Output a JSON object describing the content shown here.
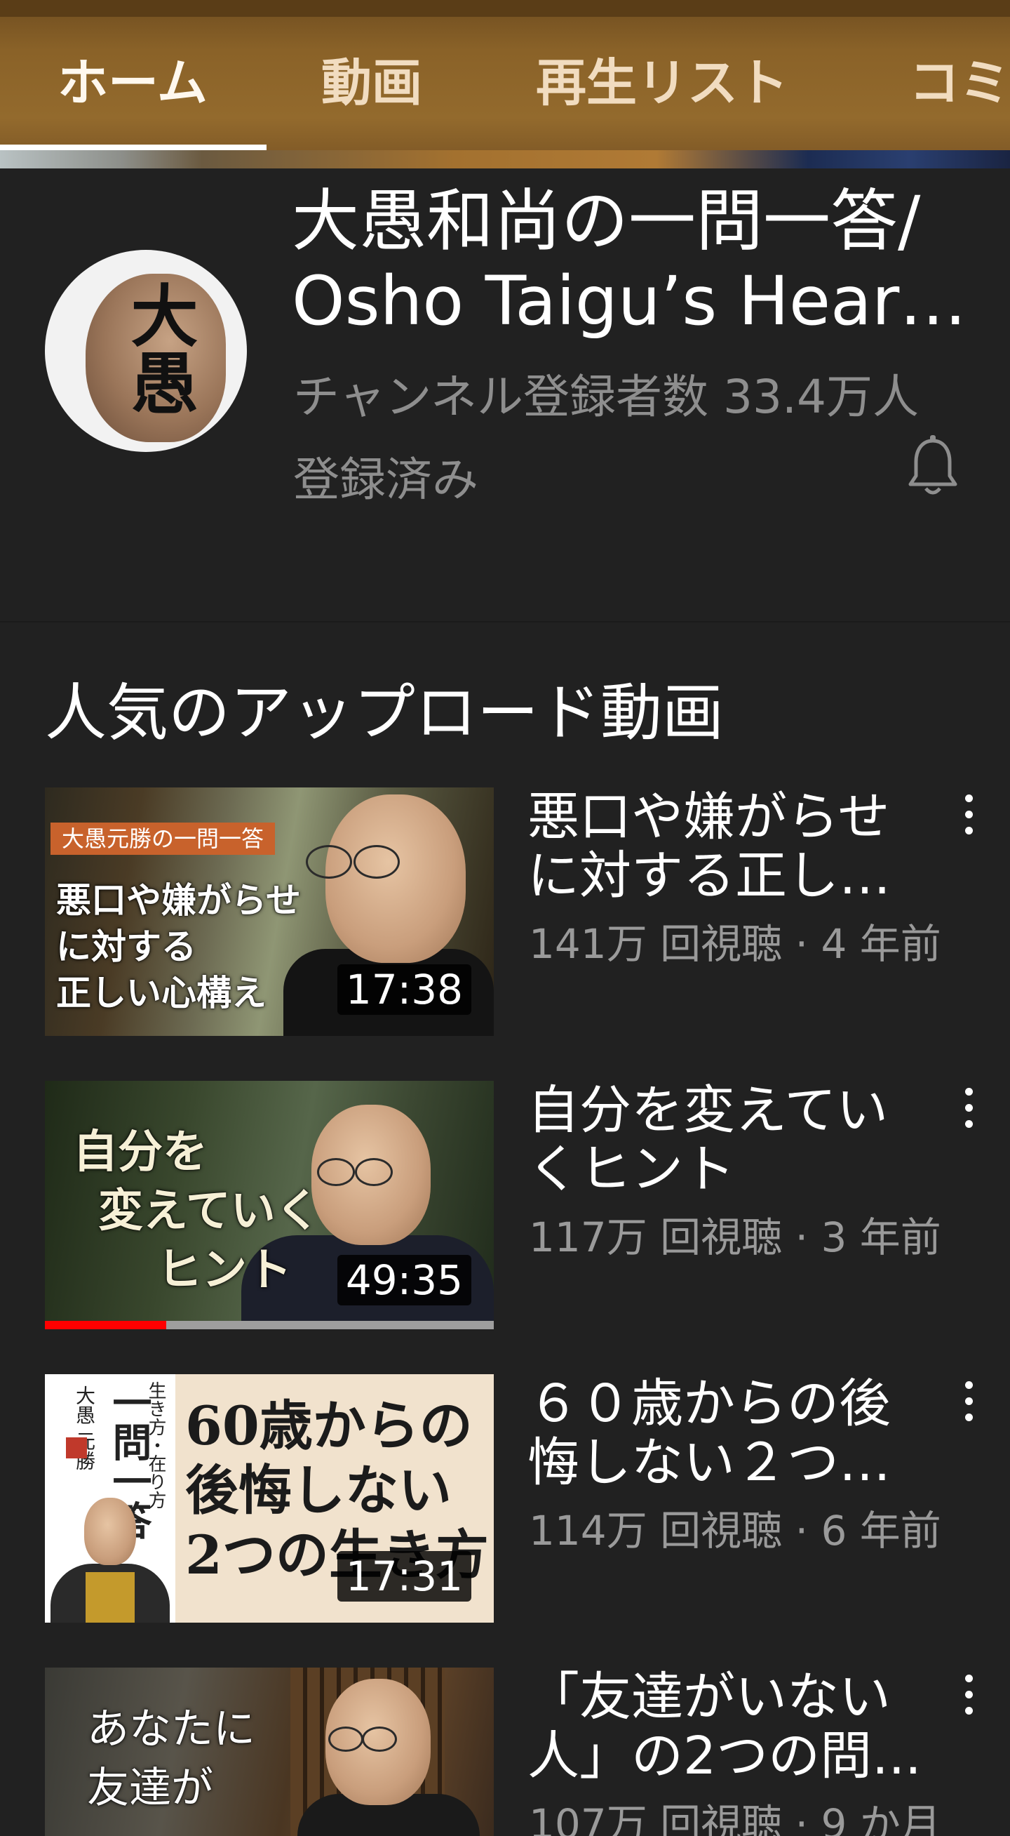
{
  "tabs": [
    "ホーム",
    "動画",
    "再生リスト",
    "コミ"
  ],
  "channel": {
    "title_line1": "大愚和尚の一問一答/",
    "title_line2": "Osho Taigu’s Heart ...",
    "subscribers": "チャンネル登録者数 33.4万人",
    "subscribed": "登録済み",
    "avatar_text": "大愚"
  },
  "section": {
    "title": "人気のアップロード動画"
  },
  "videos": [
    {
      "title_l1": "悪口や嫌がらせ",
      "title_l2": "に対する正しい...",
      "meta": "141万 回視聴 · 4 年前",
      "duration": "17:38",
      "thumb_tag": "大愚元勝の一問一答",
      "thumb_text": [
        "悪口や嫌がらせ",
        "に対する",
        "正しい心構え"
      ]
    },
    {
      "title_l1": "自分を変えてい",
      "title_l2": "くヒント",
      "meta": "117万 回視聴 · 3 年前",
      "duration": "49:35",
      "thumb_text": [
        "自分を",
        "変えていく",
        "ヒント"
      ],
      "watched_fraction": 0.27
    },
    {
      "title_l1": "６０歳からの後",
      "title_l2": "悔しない２つの...",
      "meta": "114万 回視聴 · 6 年前",
      "duration": "17:31",
      "thumb_text": [
        "60歳からの",
        "後悔しない",
        "2つの生き方"
      ],
      "thumb_side": [
        "生き方・在り方",
        "一問一答",
        "大愚 元勝"
      ]
    },
    {
      "title_l1": "「友達がいない",
      "title_l2": "人」の2つの問...",
      "meta": "107万 回視聴 · 9 か月",
      "thumb_text": [
        "あなたに",
        "友達が"
      ]
    }
  ]
}
